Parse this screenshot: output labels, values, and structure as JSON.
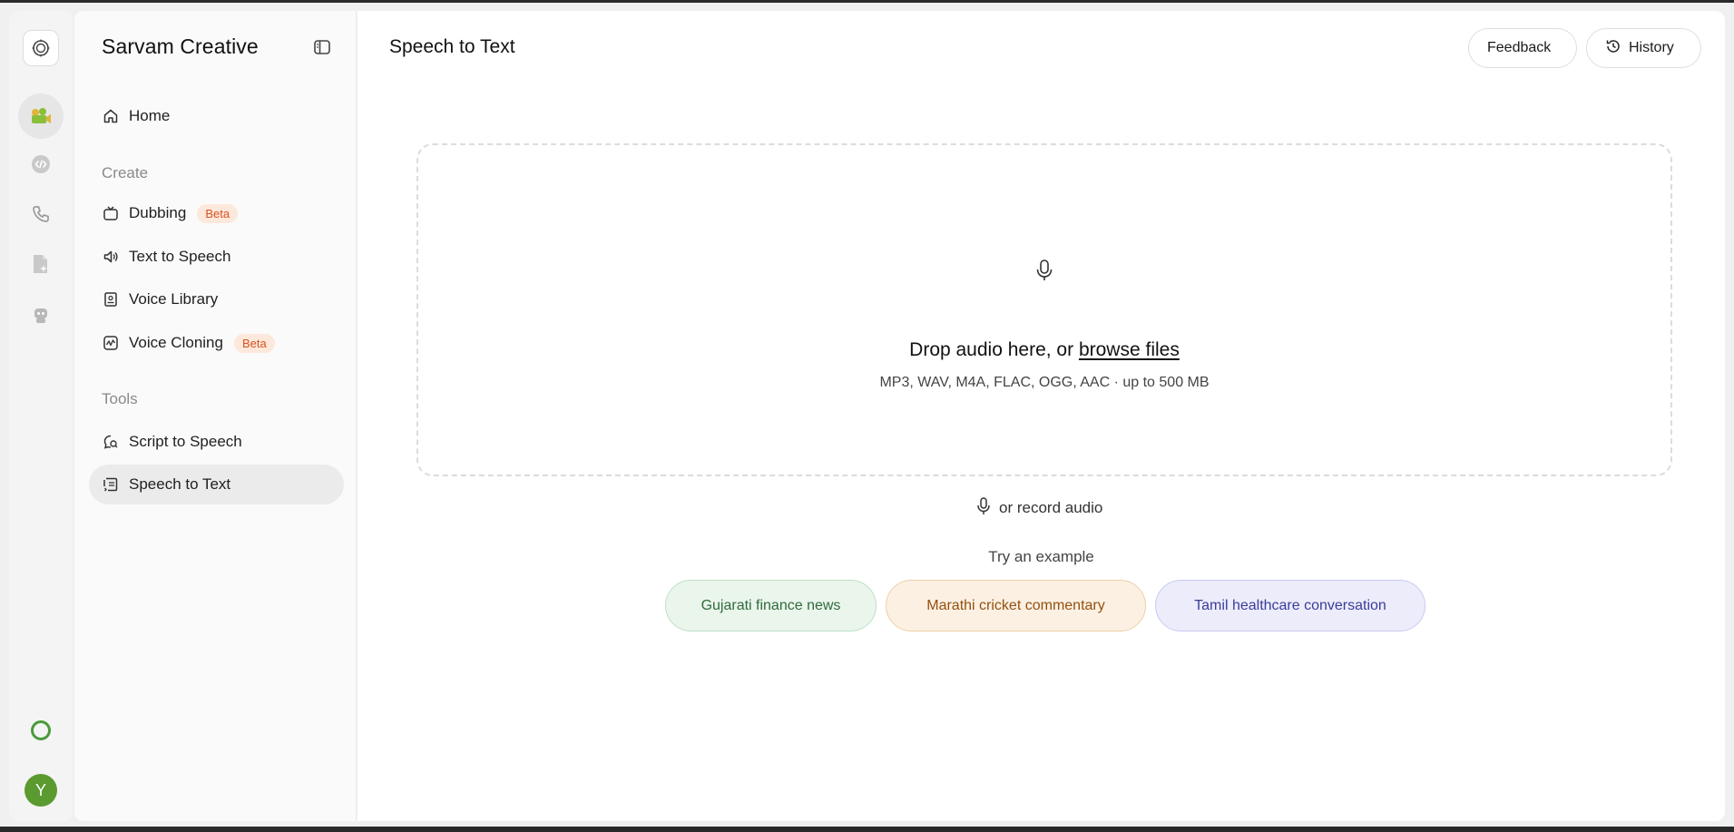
{
  "app": {
    "brand": "Sarvam Creative",
    "page_title": "Speech to Text"
  },
  "rail": {
    "icons": [
      "sarvam-logo-icon",
      "film-camera-icon",
      "code-icon",
      "phone-icon",
      "file-sparkle-icon",
      "robot-icon"
    ],
    "status_icon": "ring-icon",
    "avatar_initial": "Y",
    "avatar_color": "#5a9a2f"
  },
  "sidebar": {
    "home": "Home",
    "create_label": "Create",
    "create_items": [
      {
        "label": "Dubbing",
        "badge": "Beta"
      },
      {
        "label": "Text to Speech"
      },
      {
        "label": "Voice Library"
      },
      {
        "label": "Voice Cloning",
        "badge": "Beta"
      }
    ],
    "tools_label": "Tools",
    "tools_items": [
      {
        "label": "Script to Speech"
      },
      {
        "label": "Speech to Text",
        "active": true
      }
    ]
  },
  "header": {
    "feedback": "Feedback",
    "history": "History"
  },
  "dropzone": {
    "title_prefix": "Drop audio here, or",
    "browse_link": "browse files",
    "subtitle": "MP3, WAV, M4A, FLAC, OGG, AAC · up to 500 MB"
  },
  "record": {
    "label": "or record audio"
  },
  "examples": {
    "label": "Try an example",
    "items": [
      {
        "label": "Gujarati finance news",
        "color": "#2f6b3b"
      },
      {
        "label": "Marathi cricket commentary",
        "color": "#94500f"
      },
      {
        "label": "Tamil healthcare conversation",
        "color": "#3a3d9a"
      }
    ]
  }
}
